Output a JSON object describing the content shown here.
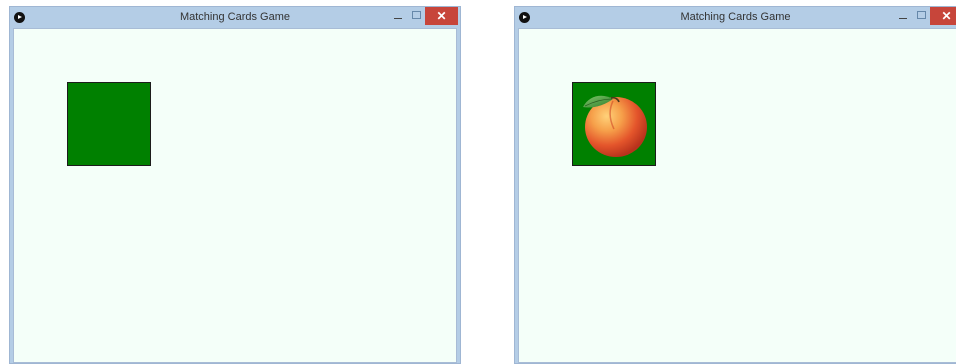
{
  "windows": [
    {
      "title": "Matching Cards Game",
      "card": {
        "state": "face-down",
        "back_color": "#008000"
      },
      "close_glyph": "✕"
    },
    {
      "title": "Matching Cards Game",
      "card": {
        "state": "face-up",
        "back_color": "#008000",
        "image": "peach"
      },
      "close_glyph": "✕"
    }
  ],
  "colors": {
    "client_background": "#f4fff9",
    "titlebar": "#b4cde6",
    "close_button": "#c7453a"
  },
  "icons": [
    "app-icon",
    "minimize-icon",
    "maximize-icon",
    "close-icon",
    "peach-image"
  ]
}
